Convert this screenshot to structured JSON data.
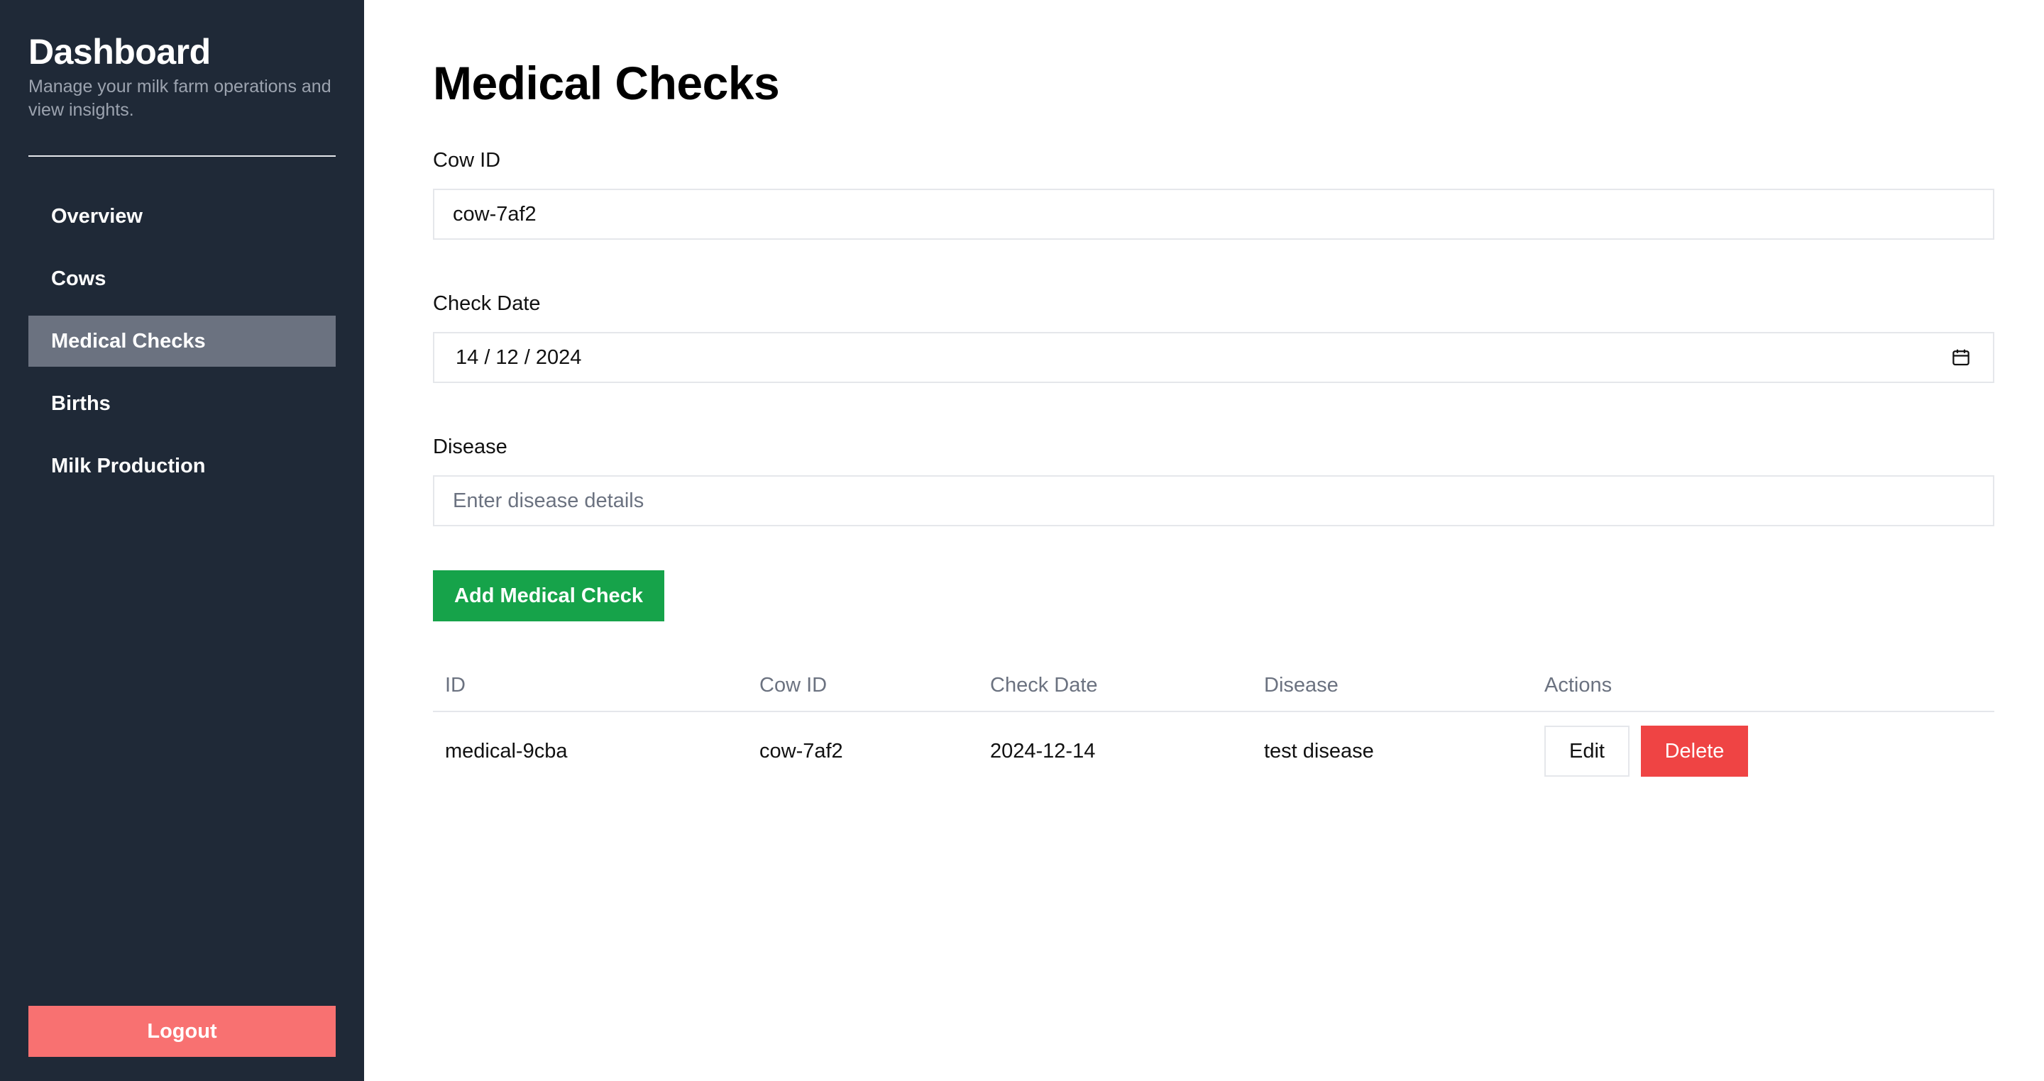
{
  "sidebar": {
    "title": "Dashboard",
    "subtitle": "Manage your milk farm operations and view insights.",
    "nav": [
      {
        "label": "Overview"
      },
      {
        "label": "Cows"
      },
      {
        "label": "Medical Checks",
        "active": true
      },
      {
        "label": "Births"
      },
      {
        "label": "Milk Production"
      }
    ],
    "logout_label": "Logout"
  },
  "main": {
    "title": "Medical Checks",
    "form": {
      "cow_id": {
        "label": "Cow ID",
        "value": "cow-7af2"
      },
      "check_date": {
        "label": "Check Date",
        "value": "14 / 12 / 2024",
        "icon": "calendar-icon"
      },
      "disease": {
        "label": "Disease",
        "value": "",
        "placeholder": "Enter disease details"
      },
      "submit_label": "Add Medical Check"
    },
    "table": {
      "columns": [
        "ID",
        "Cow ID",
        "Check Date",
        "Disease",
        "Actions"
      ],
      "rows": [
        {
          "id": "medical-9cba",
          "cow_id": "cow-7af2",
          "check_date": "2024-12-14",
          "disease": "test disease",
          "edit_label": "Edit",
          "delete_label": "Delete"
        }
      ]
    }
  },
  "colors": {
    "sidebar_bg": "#1f2937",
    "active_nav_bg": "#6b7280",
    "logout_bg": "#f87171",
    "primary_green": "#16a34a",
    "danger_red": "#ef4444"
  }
}
